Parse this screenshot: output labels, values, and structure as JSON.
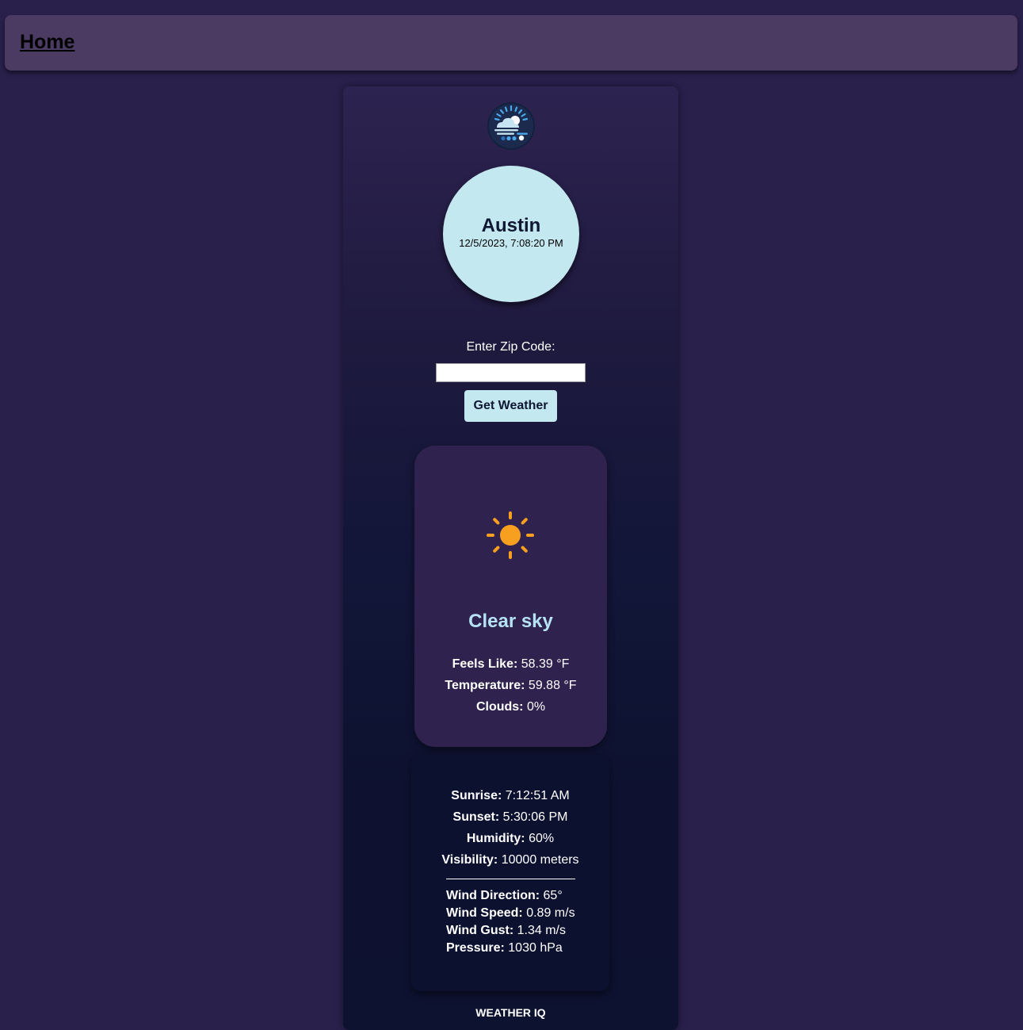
{
  "nav": {
    "home_label": "Home"
  },
  "location": {
    "city": "Austin",
    "datetime": "12/5/2023, 7:08:20 PM"
  },
  "form": {
    "zip_label": "Enter Zip Code:",
    "zip_value": "",
    "button_label": "Get Weather"
  },
  "current": {
    "icon": "sun-icon",
    "condition": "Clear sky",
    "feels_like_label": "Feels Like:",
    "feels_like": "58.39 °F",
    "temperature_label": "Temperature:",
    "temperature": "59.88 °F",
    "clouds_label": "Clouds:",
    "clouds": "0%"
  },
  "details": {
    "sunrise_label": "Sunrise:",
    "sunrise": "7:12:51 AM",
    "sunset_label": "Sunset:",
    "sunset": "5:30:06 PM",
    "humidity_label": "Humidity:",
    "humidity": "60%",
    "visibility_label": "Visibility:",
    "visibility": "10000 meters",
    "wind_direction_label": "Wind Direction:",
    "wind_direction": "65°",
    "wind_speed_label": "Wind Speed:",
    "wind_speed": "0.89 m/s",
    "wind_gust_label": "Wind Gust:",
    "wind_gust": "1.34 m/s",
    "pressure_label": "Pressure:",
    "pressure": "1030 hPa"
  },
  "footer": {
    "brand": "WEATHER IQ"
  },
  "colors": {
    "background": "#29204c",
    "topbar": "#4b3a62",
    "accent": "#c3e8f0",
    "condition_text": "#b6e2f5",
    "sun": "#f7a01f"
  }
}
